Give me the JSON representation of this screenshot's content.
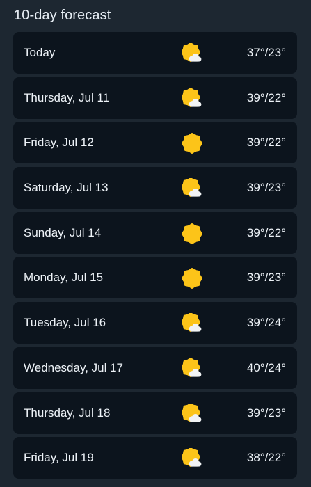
{
  "header": {
    "title": "10-day forecast"
  },
  "colors": {
    "sun": "#fcc419",
    "cloud": "#f1f3f5",
    "background": "#1d2731",
    "card": "#0c141d"
  },
  "days": [
    {
      "day": "Today",
      "icon": "partly-cloudy-icon",
      "temp": "37°/23°"
    },
    {
      "day": "Thursday, Jul 11",
      "icon": "partly-cloudy-icon",
      "temp": "39°/22°"
    },
    {
      "day": "Friday, Jul 12",
      "icon": "sunny-icon",
      "temp": "39°/22°"
    },
    {
      "day": "Saturday, Jul 13",
      "icon": "partly-cloudy-icon",
      "temp": "39°/23°"
    },
    {
      "day": "Sunday, Jul 14",
      "icon": "sunny-icon",
      "temp": "39°/22°"
    },
    {
      "day": "Monday, Jul 15",
      "icon": "sunny-icon",
      "temp": "39°/23°"
    },
    {
      "day": "Tuesday, Jul 16",
      "icon": "partly-cloudy-icon",
      "temp": "39°/24°"
    },
    {
      "day": "Wednesday, Jul 17",
      "icon": "partly-cloudy-icon",
      "temp": "40°/24°"
    },
    {
      "day": "Thursday, Jul 18",
      "icon": "partly-cloudy-icon",
      "temp": "39°/23°"
    },
    {
      "day": "Friday, Jul 19",
      "icon": "partly-cloudy-icon",
      "temp": "38°/22°"
    }
  ]
}
